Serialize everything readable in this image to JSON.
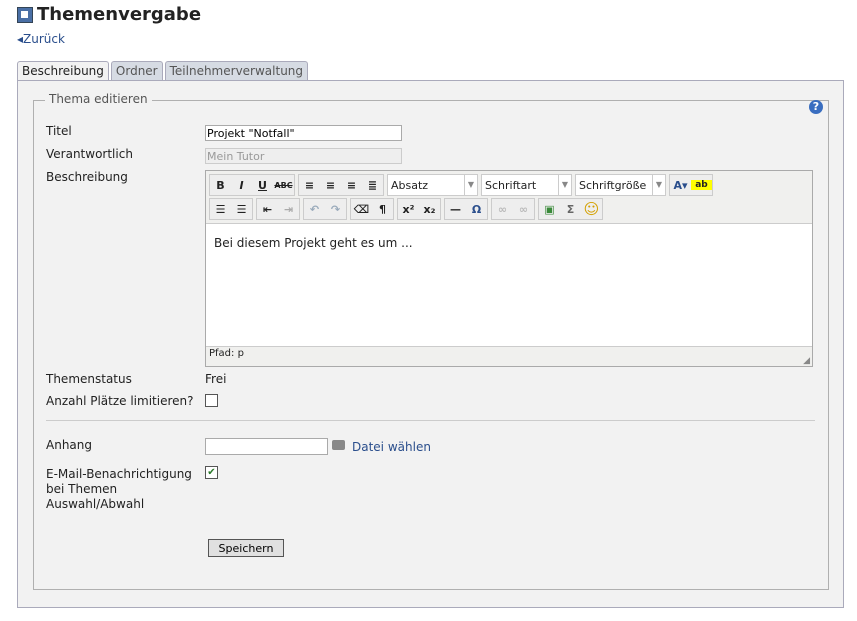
{
  "header": {
    "title": "Themenvergabe",
    "back_label": "Zurück"
  },
  "tabs": [
    {
      "label": "Beschreibung",
      "active": true
    },
    {
      "label": "Ordner"
    },
    {
      "label": "Teilnehmerverwaltung"
    }
  ],
  "form": {
    "legend": "Thema editieren",
    "help": "?",
    "titel_label": "Titel",
    "titel_value": "Projekt \"Notfall\"",
    "verantwortlich_label": "Verantwortlich",
    "verantwortlich_value": "Mein Tutor",
    "beschreibung_label": "Beschreibung",
    "editor": {
      "format": "Absatz",
      "font": "Schriftart",
      "size": "Schriftgröße",
      "content": "Bei diesem Projekt geht es um ...",
      "path": "Pfad: p"
    },
    "status_label": "Themenstatus",
    "status_value": "Frei",
    "limit_label": "Anzahl Plätze limitieren?",
    "anhang_label": "Anhang",
    "file_button": "Datei wählen",
    "email_label_1": "E-Mail-Benachrichtigung",
    "email_label_2": "bei Themen",
    "email_label_3": "Auswahl/Abwahl",
    "email_checked": true,
    "save": "Speichern"
  }
}
